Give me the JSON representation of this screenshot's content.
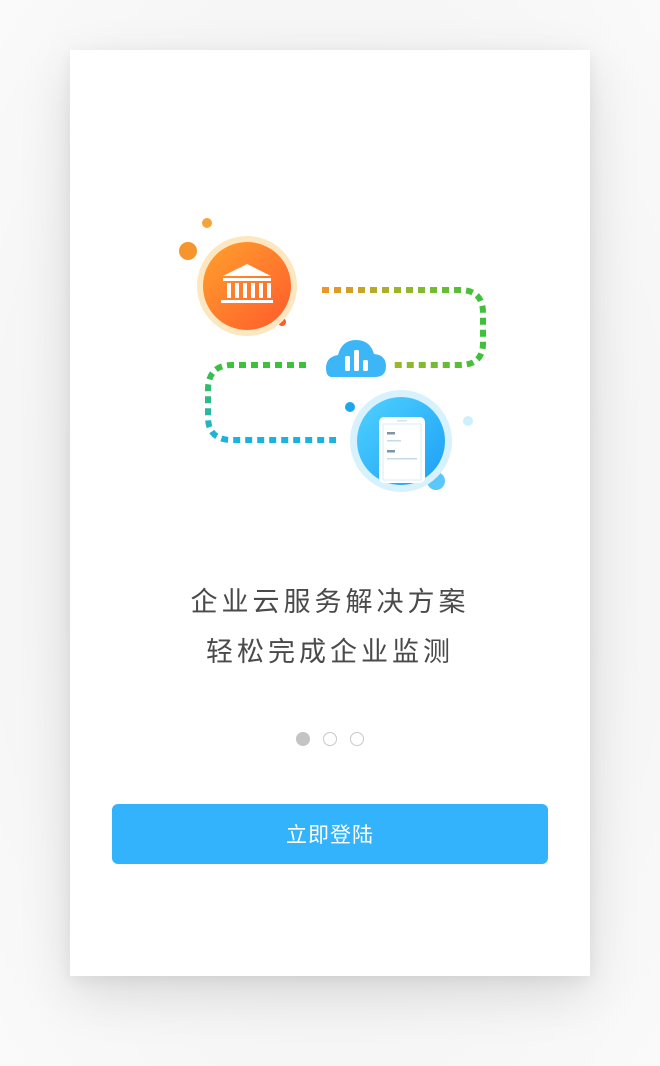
{
  "onboarding": {
    "headline_line1": "企业云服务解决方案",
    "headline_line2": "轻松完成企业监测",
    "pager": {
      "total_pages": 3,
      "current_page": 1
    },
    "login_button_label": "立即登陆"
  },
  "illustration": {
    "icons": [
      "bank-icon",
      "cloud-chart-icon",
      "phone-document-icon"
    ]
  },
  "colors": {
    "accent": "#33b3fb",
    "orange": "#ff8a2a",
    "green": "#3cc13b",
    "teal": "#29b7d6",
    "text": "#4a4a4a",
    "dot_active": "#c4c4c4"
  }
}
